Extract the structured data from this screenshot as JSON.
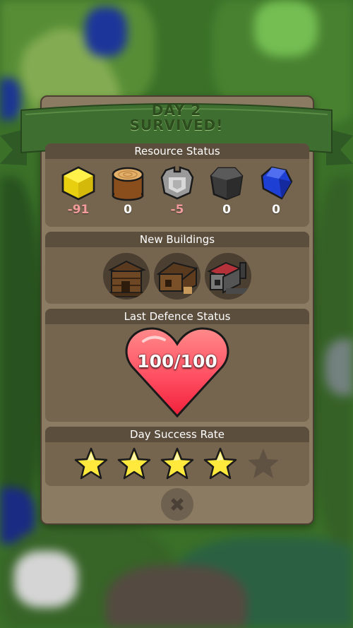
{
  "banner": {
    "line1": "DAY 2",
    "line2": "SURVIVED!"
  },
  "resource_status": {
    "heading": "Resource Status",
    "items": [
      {
        "icon": "gold-cube-icon",
        "value": "-91",
        "color": "#f2dd1c"
      },
      {
        "icon": "wood-log-icon",
        "value": "0",
        "color": "#a8692f"
      },
      {
        "icon": "stone-block-icon",
        "value": "-5",
        "color": "#b7b7b7"
      },
      {
        "icon": "iron-block-icon",
        "value": "0",
        "color": "#3b3b3b"
      },
      {
        "icon": "blue-gem-icon",
        "value": "0",
        "color": "#1f3fd6"
      }
    ]
  },
  "new_buildings": {
    "heading": "New Buildings",
    "items": [
      "wooden-tower-icon",
      "wooden-hut-icon",
      "stone-forge-icon"
    ]
  },
  "last_defence": {
    "heading": "Last Defence Status",
    "health": "100/100",
    "health_fraction": 1.0,
    "heart_color": "#ff5a6e"
  },
  "day_success": {
    "heading": "Day Success Rate",
    "stars_filled": 4,
    "stars_total": 5
  },
  "close_icon": "close-x-icon"
}
